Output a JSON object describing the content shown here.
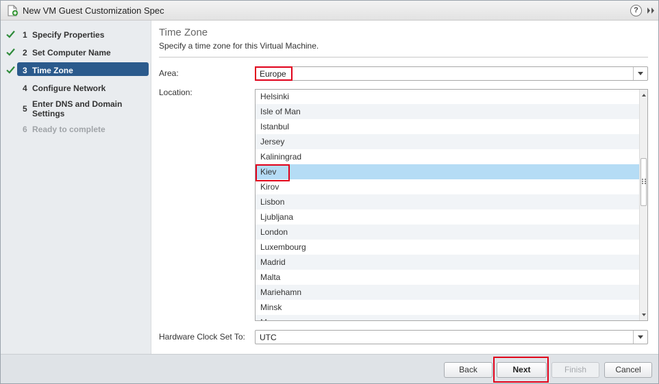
{
  "window": {
    "title": "New VM Guest Customization Spec",
    "title_icon": "customization-spec-icon",
    "help_label": "?",
    "expand_icon": "double-chevron-right-icon"
  },
  "steps": [
    {
      "number": "1",
      "label": "Specify Properties",
      "state": "completed"
    },
    {
      "number": "2",
      "label": "Set Computer Name",
      "state": "completed"
    },
    {
      "number": "3",
      "label": "Time Zone",
      "state": "active"
    },
    {
      "number": "4",
      "label": "Configure Network",
      "state": "pending"
    },
    {
      "number": "5",
      "label_line1": "Enter DNS and Domain",
      "label_line2": "Settings",
      "state": "pending"
    },
    {
      "number": "6",
      "label": "Ready to complete",
      "state": "disabled"
    }
  ],
  "page": {
    "heading": "Time Zone",
    "subheading": "Specify a time zone for this Virtual Machine."
  },
  "form": {
    "area_label": "Area:",
    "area_value": "Europe",
    "location_label": "Location:",
    "locations": [
      "Helsinki",
      "Isle of Man",
      "Istanbul",
      "Jersey",
      "Kaliningrad",
      "Kiev",
      "Kirov",
      "Lisbon",
      "Ljubljana",
      "London",
      "Luxembourg",
      "Madrid",
      "Malta",
      "Mariehamn",
      "Minsk",
      "Monaco"
    ],
    "selected_location": "Kiev",
    "hardware_clock_label": "Hardware Clock Set To:",
    "hardware_clock_value": "UTC"
  },
  "buttons": {
    "back": "Back",
    "next": "Next",
    "finish": "Finish",
    "cancel": "Cancel"
  },
  "colors": {
    "active_step": "#2b5a8c",
    "check": "#2e8b3a",
    "selection": "#b5dcf5",
    "annotation_red": "#e0001a"
  }
}
